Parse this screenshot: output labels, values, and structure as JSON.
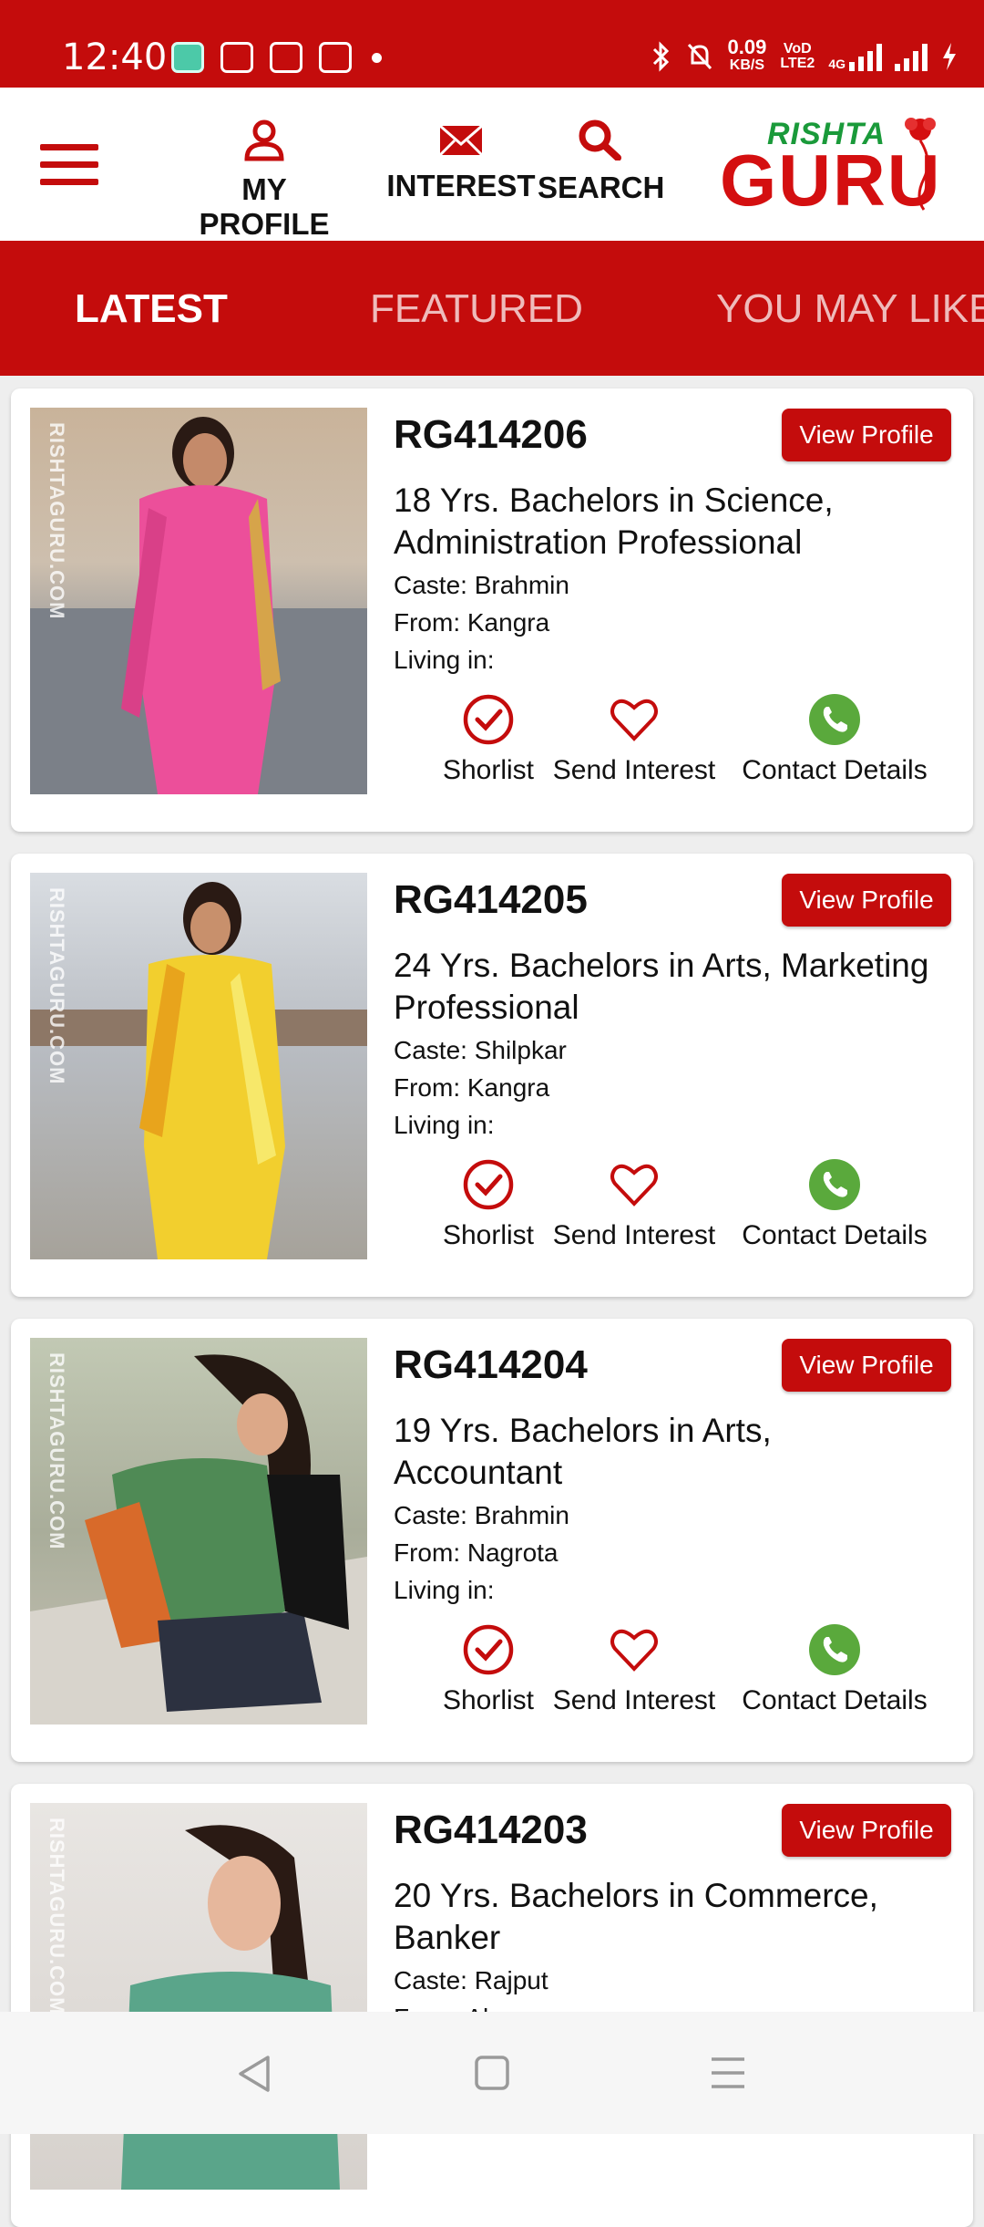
{
  "status_bar": {
    "time": "12:40",
    "speed_value": "0.09",
    "speed_unit": "KB/S",
    "volte": "VoD LTE2",
    "network": "4G"
  },
  "header": {
    "menu_icon": "hamburger-menu-icon",
    "nav": [
      {
        "label": "MY PROFILE",
        "icon": "person-icon"
      },
      {
        "label": "INTEREST",
        "icon": "envelope-icon"
      },
      {
        "label": "SEARCH",
        "icon": "search-icon"
      }
    ],
    "logo": {
      "top": "RISHTA",
      "main": "GURU"
    }
  },
  "tabs": [
    {
      "label": "LATEST",
      "active": true
    },
    {
      "label": "FEATURED",
      "active": false
    },
    {
      "label": "YOU MAY LIKE",
      "active": false
    }
  ],
  "watermark": "RISHTAGURU.COM",
  "view_profile_label": "View Profile",
  "actions": {
    "shortlist": "Shorlist",
    "send_interest": "Send Interest",
    "contact": "Contact Details"
  },
  "profiles": [
    {
      "id": "RG414206",
      "headline": "18 Yrs. Bachelors in Science, Administration Professional",
      "caste": "Caste: Brahmin",
      "from": "From: Kangra",
      "living": "Living in:"
    },
    {
      "id": "RG414205",
      "headline": "24 Yrs. Bachelors in Arts, Marketing Professional",
      "caste": "Caste: Shilpkar",
      "from": "From: Kangra",
      "living": "Living in:"
    },
    {
      "id": "RG414204",
      "headline": "19 Yrs. Bachelors in Arts, Accountant",
      "caste": "Caste: Brahmin",
      "from": "From: Nagrota",
      "living": "Living in:"
    },
    {
      "id": "RG414203",
      "headline": "20 Yrs. Bachelors in Commerce, Banker",
      "caste": "Caste: Rajput",
      "from": "From: Ab",
      "living": ""
    }
  ],
  "colors": {
    "brand_red": "#c40c0c",
    "logo_green": "#1a9a3a",
    "contact_green": "#5aa93c"
  }
}
